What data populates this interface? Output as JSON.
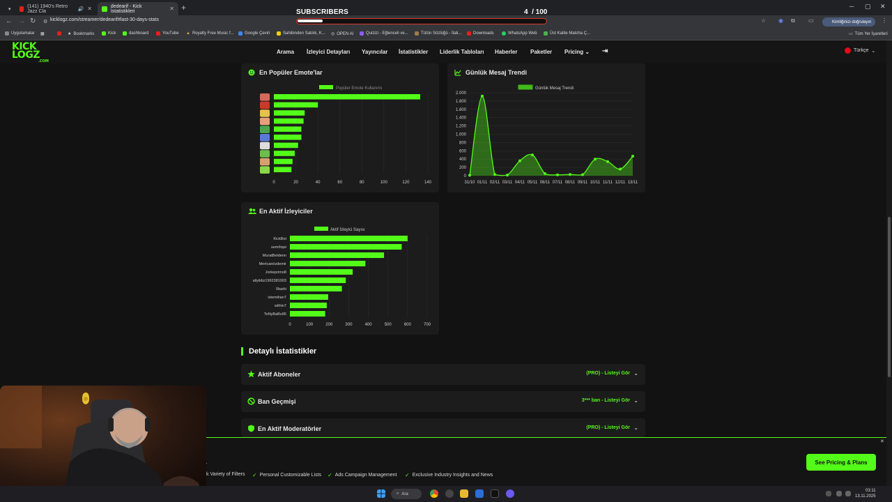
{
  "browser": {
    "tabs": [
      {
        "title": "(141) 1940's Retro Jazz Cla",
        "icon": "youtube-icon",
        "active": false
      },
      {
        "title": "dedearif - Kick İstatistikleri",
        "icon": "kick-icon",
        "active": true
      }
    ],
    "url": "kicklogz.com/streamer/dedearif#last-30-days-stats",
    "profile_label": "Kimliğinizi doğrulayın",
    "bookmarks": [
      "Uygulamalar",
      "Bookmarks",
      "Kick",
      "dashboard",
      "YouTube",
      "Royalty Free Music f...",
      "Google Çeviri",
      "Sahibinden Satılık, K...",
      "OPEN AI",
      "Quizizi - Eğlenceli ve...",
      "Tütün Sözlüğü - İtali...",
      "Downloads",
      "WhatsApp Web",
      "Üst Kalite Matcha Ç..."
    ],
    "all_bookmarks": "Tüm Yer İşaretleri"
  },
  "overlay": {
    "title": "SUBSCRIBERS",
    "current": "4",
    "goal": "/ 100",
    "progress": 0.04
  },
  "site": {
    "logo_top": "KICK",
    "logo_bottom": "LOGZ",
    "logo_sub": ".COM",
    "nav": [
      "Arama",
      "İzleyici Detayları",
      "Yayıncılar",
      "İstatistikler",
      "Liderlik Tabloları",
      "Haberler",
      "Paketler",
      "Pricing"
    ],
    "language": "Türkçe"
  },
  "emotes_card": {
    "title": "En Popüler Emote'lar",
    "legend": "Popüler Emote Kullanımı"
  },
  "messages_card": {
    "title": "Günlük Mesaj Trendi",
    "legend": "Günlük Mesaj Trendi"
  },
  "viewers_card": {
    "title": "En Aktif İzleyiciler",
    "legend": "Aktif İzleyici Sayısı"
  },
  "chart_data": [
    {
      "type": "bar",
      "orientation": "horizontal",
      "series": [
        {
          "name": "Popüler Emote Kullanımı",
          "values": [
            133,
            40,
            28,
            27,
            25,
            25,
            22,
            19,
            17,
            16
          ]
        }
      ],
      "xlim": [
        0,
        140
      ],
      "xticks": [
        "0",
        "20",
        "40",
        "60",
        "80",
        "100",
        "120",
        "140"
      ],
      "color": "#53fc18"
    },
    {
      "type": "area",
      "x": [
        "31/10",
        "01/11",
        "02/11",
        "03/11",
        "04/11",
        "05/11",
        "06/11",
        "07/11",
        "08/11",
        "09/11",
        "10/11",
        "11/11",
        "12/11",
        "13/11"
      ],
      "series": [
        {
          "name": "Günlük Mesaj Trendi",
          "values": [
            10,
            1920,
            30,
            15,
            360,
            500,
            50,
            20,
            30,
            25,
            400,
            340,
            160,
            470
          ]
        }
      ],
      "ylim": [
        0,
        2000
      ],
      "yticks": [
        "0",
        "200",
        "400",
        "600",
        "800",
        "1.000",
        "1.200",
        "1.400",
        "1.600",
        "1.800",
        "2.000"
      ],
      "color": "#53fc18"
    },
    {
      "type": "bar",
      "orientation": "horizontal",
      "categories": [
        "KickBot",
        "semihqei",
        "MuratBeldenn",
        "Mertcanözdemir",
        "Jorkeprimo8",
        "aliyildiz1992381903",
        "0barki",
        "istemihan7",
        "within7",
        "TeNyBaBo95"
      ],
      "series": [
        {
          "name": "Aktif İzleyici Sayısı",
          "values": [
            600,
            570,
            480,
            385,
            320,
            285,
            265,
            195,
            188,
            180
          ]
        }
      ],
      "xlim": [
        0,
        700
      ],
      "xticks": [
        "0",
        "100",
        "200",
        "300",
        "400",
        "500",
        "600",
        "700"
      ],
      "color": "#53fc18"
    }
  ],
  "details": {
    "section_title": "Detaylı İstatistikler",
    "items": [
      {
        "label": "Aktif Aboneler",
        "icon": "star-icon",
        "action": "(PRO) - Listeyi Gör"
      },
      {
        "label": "Ban Geçmişi",
        "icon": "ban-icon",
        "action": "3*** ban - Listeyi Gör"
      },
      {
        "label": "En Aktif Moderatörler",
        "icon": "shield-icon",
        "action": "(PRO) - Listeyi Gör"
      }
    ]
  },
  "promo": {
    "partial_text": "s.",
    "features": [
      "k Variety of Filters",
      "Personal Customizable Lists",
      "Ads Campaign Management",
      "Exclusive Industry Insights and News"
    ],
    "cta": "See Pricing & Plans"
  },
  "taskbar": {
    "search": "Ara",
    "time": "03:11",
    "date": "13.11.2025"
  }
}
